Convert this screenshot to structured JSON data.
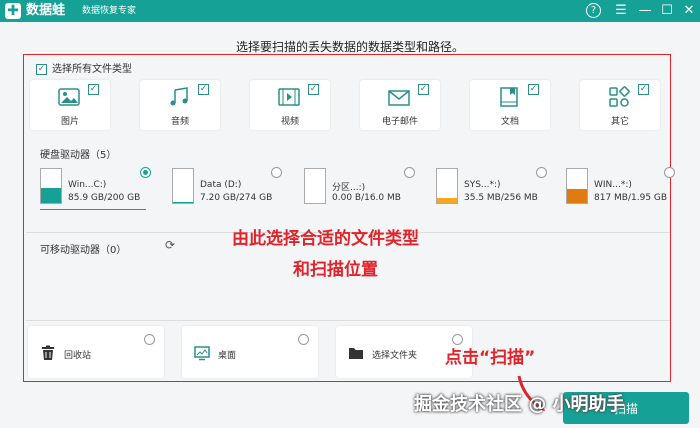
{
  "app": {
    "name": "数据蛙",
    "subtitle": "数据恢复专家",
    "logo_glyph": "✚"
  },
  "window_controls": {
    "help": "?",
    "menu": "☰",
    "minimize": "—",
    "maximize": "☐",
    "close": "✕"
  },
  "instruction": "选择要扫描的丢失数据的数据类型和路径。",
  "select_all": {
    "label": "选择所有文件类型",
    "checked": true
  },
  "file_types": [
    {
      "label": "图片",
      "icon": "image-icon",
      "checked": true
    },
    {
      "label": "音频",
      "icon": "music-icon",
      "checked": true
    },
    {
      "label": "视频",
      "icon": "video-icon",
      "checked": true
    },
    {
      "label": "电子邮件",
      "icon": "email-icon",
      "checked": true
    },
    {
      "label": "文档",
      "icon": "document-icon",
      "checked": true
    },
    {
      "label": "其它",
      "icon": "other-icon",
      "checked": true
    }
  ],
  "hdd": {
    "title": "硬盘驱动器（5）",
    "drives": [
      {
        "name": "Win...C:)",
        "size": "85.9 GB/200 GB",
        "selected": true,
        "used_fraction": 0.43,
        "color": "#16a196"
      },
      {
        "name": "Data (D:)",
        "size": "7.20 GB/274 GB",
        "selected": false,
        "used_fraction": 0.03,
        "color": "#16a196"
      },
      {
        "name": "分区...:)",
        "size": "0.00  B/16.0 MB",
        "selected": false,
        "used_fraction": 0.0,
        "color": "#f5a623"
      },
      {
        "name": "SYS...*:)",
        "size": "35.5 MB/256 MB",
        "selected": false,
        "used_fraction": 0.14,
        "color": "#f5a623"
      },
      {
        "name": "WIN...*:)",
        "size": "817 MB/1.95 GB",
        "selected": false,
        "used_fraction": 0.42,
        "color": "#e07b10"
      }
    ]
  },
  "removable": {
    "title": "可移动驱动器（0）",
    "refresh_icon": "refresh-icon"
  },
  "locations": [
    {
      "label": "回收站",
      "icon": "trash-icon"
    },
    {
      "label": "桌面",
      "icon": "desktop-icon"
    },
    {
      "label": "选择文件夹",
      "icon": "folder-icon"
    }
  ],
  "annotations": {
    "line1": "由此选择合适的文件类型",
    "line2": "和扫描位置",
    "scan_hint": "点击“扫描”"
  },
  "scan_button": {
    "label": "扫描"
  },
  "watermark": "掘金技术社区 @ 小明助手",
  "colors": {
    "brand": "#16a196",
    "annotation": "#e0242b"
  }
}
